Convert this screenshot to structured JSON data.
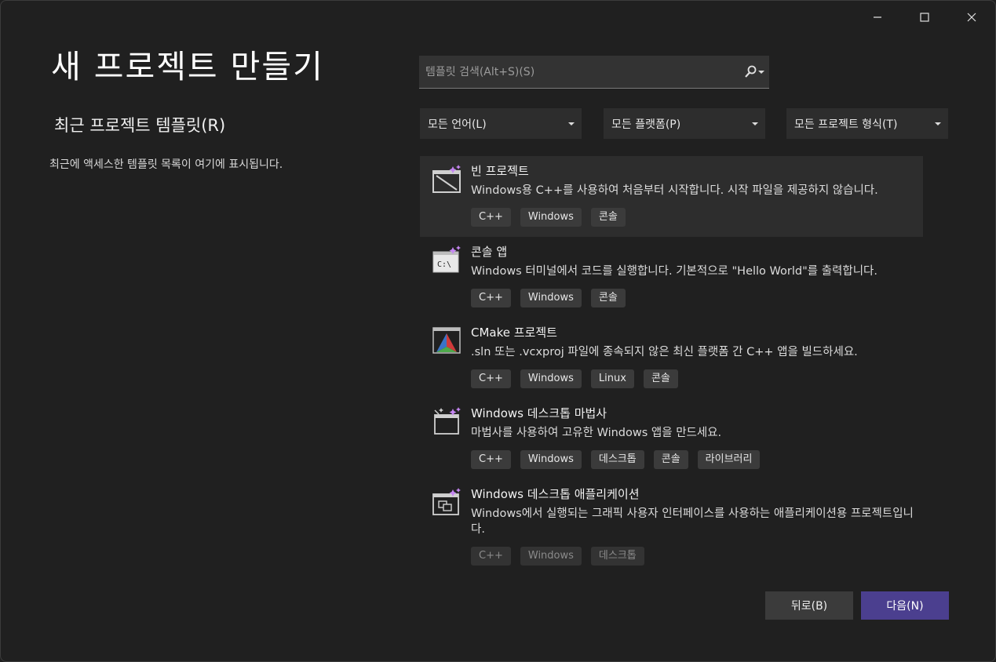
{
  "page": {
    "title": "새 프로젝트 만들기",
    "recent_title": "최근 프로젝트 템플릿(R)",
    "recent_desc": "최근에 액세스한 템플릿 목록이 여기에 표시됩니다."
  },
  "search": {
    "placeholder": "템플릿 검색(Alt+S)(S)"
  },
  "filters": {
    "language": "모든 언어(L)",
    "platform": "모든 플랫폼(P)",
    "project_type": "모든 프로젝트 형식(T)"
  },
  "templates": [
    {
      "icon": "empty-project-icon",
      "name": "빈 프로젝트",
      "desc": "Windows용 C++를 사용하여 처음부터 시작합니다. 시작 파일을 제공하지 않습니다.",
      "tags": [
        "C++",
        "Windows",
        "콘솔"
      ]
    },
    {
      "icon": "console-app-icon",
      "name": "콘솔 앱",
      "desc": "Windows 터미널에서 코드를 실행합니다. 기본적으로 \"Hello World\"를 출력합니다.",
      "tags": [
        "C++",
        "Windows",
        "콘솔"
      ]
    },
    {
      "icon": "cmake-icon",
      "name": "CMake 프로젝트",
      "desc": ".sln 또는 .vcxproj 파일에 종속되지 않은 최신 플랫폼 간 C++ 앱을 빌드하세요.",
      "tags": [
        "C++",
        "Windows",
        "Linux",
        "콘솔"
      ]
    },
    {
      "icon": "desktop-wizard-icon",
      "name": "Windows 데스크톱 마법사",
      "desc": "마법사를 사용하여 고유한 Windows 앱을 만드세요.",
      "tags": [
        "C++",
        "Windows",
        "데스크톱",
        "콘솔",
        "라이브러리"
      ]
    },
    {
      "icon": "desktop-app-icon",
      "name": "Windows 데스크톱 애플리케이션",
      "desc": "Windows에서 실행되는 그래픽 사용자 인터페이스를 사용하는 애플리케이션용 프로젝트입니다.",
      "tags": [
        "C++",
        "Windows",
        "데스크톱"
      ]
    }
  ],
  "buttons": {
    "back": "뒤로(B)",
    "next": "다음(N)"
  },
  "colors": {
    "accent": "#4b3f8f",
    "background": "#202020",
    "selected": "#2d2d2d"
  }
}
